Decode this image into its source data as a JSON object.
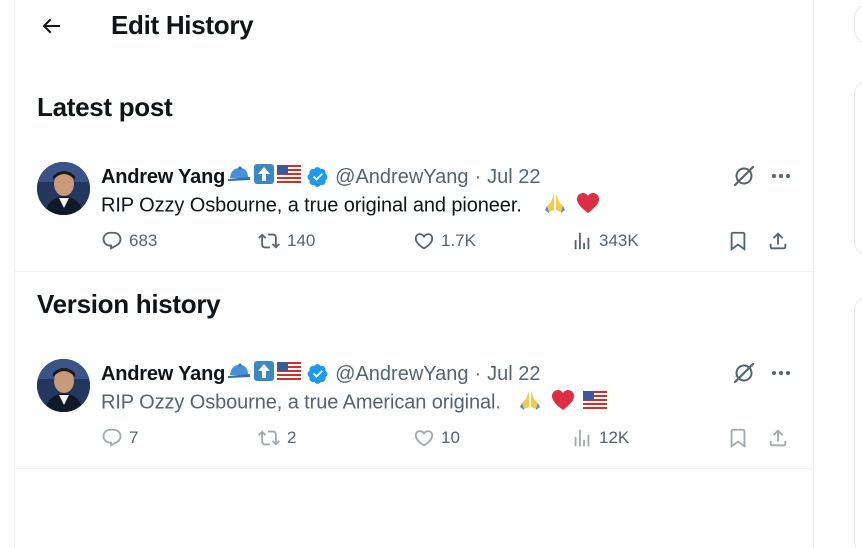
{
  "header": {
    "title": "Edit History"
  },
  "sections": {
    "latest_title": "Latest post",
    "history_title": "Version history"
  },
  "latest_post": {
    "author_name": "Andrew Yang",
    "handle": "@AndrewYang",
    "separator": "·",
    "date": "Jul 22",
    "text": "RIP Ozzy Osbourne, a true original and pioneer.",
    "text_emojis": [
      "folded-hands",
      "red-heart"
    ],
    "replies": "683",
    "reposts": "140",
    "likes": "1.7K",
    "views": "343K"
  },
  "previous_post": {
    "author_name": "Andrew Yang",
    "handle": "@AndrewYang",
    "separator": "·",
    "date": "Jul 22",
    "text": "RIP Ozzy Osbourne, a true American original.",
    "text_emojis": [
      "folded-hands",
      "red-heart",
      "us-flag"
    ],
    "replies": "7",
    "reposts": "2",
    "likes": "10",
    "views": "12K"
  },
  "name_badges": [
    "blue-cap-emoji",
    "up-arrow-emoji",
    "us-flag-emoji",
    "verified-badge-icon"
  ],
  "colors": {
    "text_primary": "#0f1419",
    "text_secondary": "#536471",
    "verified_blue": "#1d9bf0",
    "border": "#eff3f4"
  }
}
